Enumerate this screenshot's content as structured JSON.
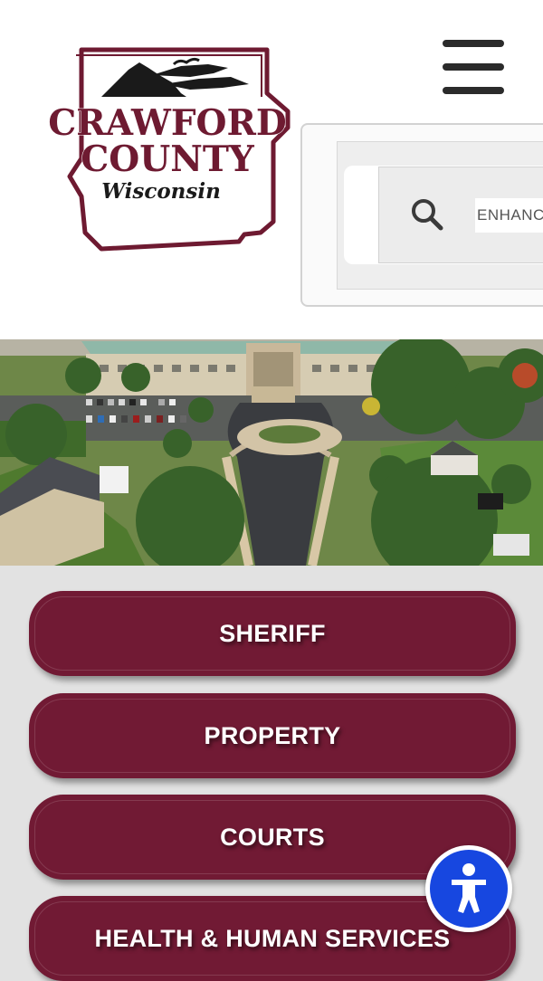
{
  "header": {
    "logo": {
      "line1": "CRAWFORD",
      "line2": "COUNTY",
      "line3": "Wisconsin"
    },
    "menu_icon": "hamburger-menu-icon",
    "search": {
      "icon": "magnifier-icon",
      "value": "ENHANCED SEARCH"
    }
  },
  "hero": {
    "image": "aerial photo of county building with roundabout driveway"
  },
  "nav": {
    "buttons": [
      {
        "label": "SHERIFF"
      },
      {
        "label": "PROPERTY"
      },
      {
        "label": "COURTS"
      },
      {
        "label": "HEALTH & HUMAN SERVICES"
      }
    ]
  },
  "accessibility": {
    "icon": "accessibility-person-icon"
  },
  "colors": {
    "brand_maroon": "#711a34",
    "accessibility_blue": "#1747e0",
    "page_background": "#e2e2e2"
  }
}
